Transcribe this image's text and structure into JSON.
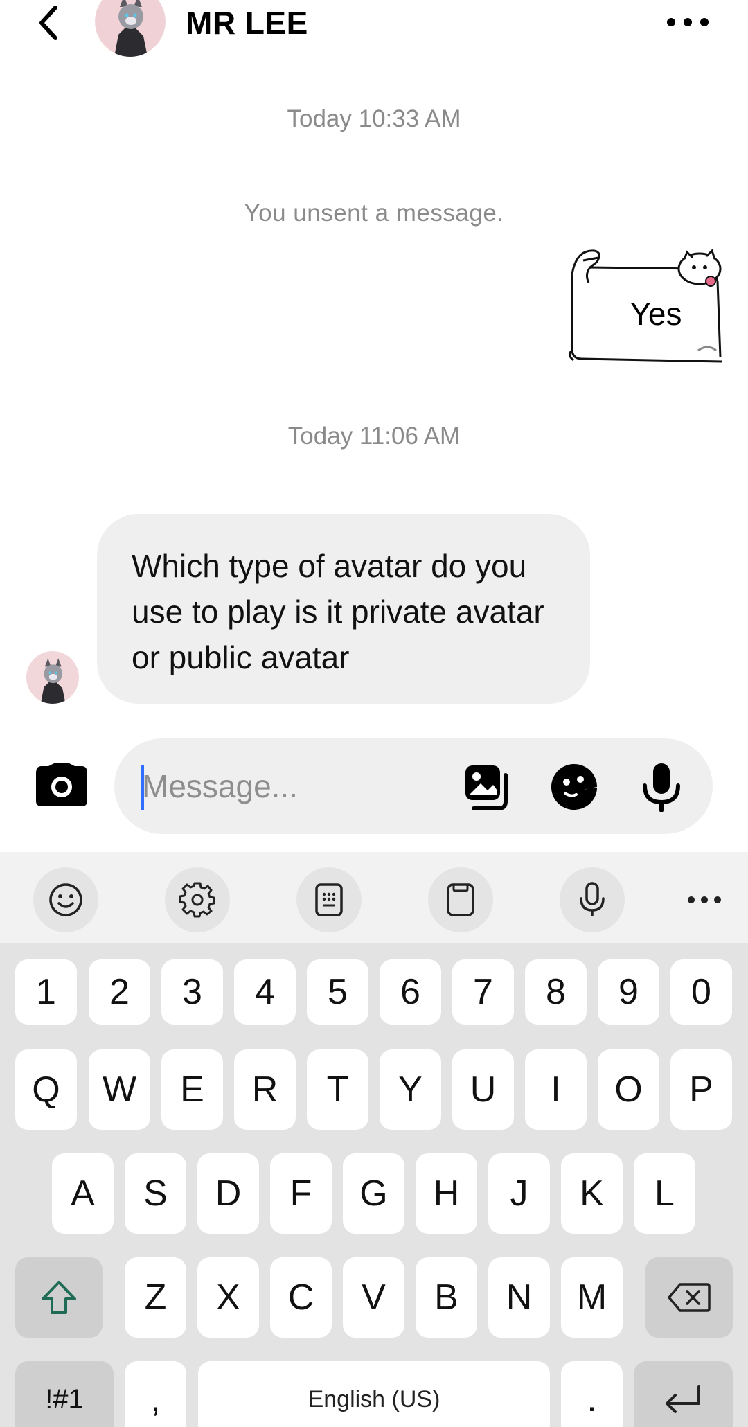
{
  "header": {
    "contact_name": "MR LEE",
    "back_icon": "chevron-left-icon",
    "more_icon": "more-horizontal-icon"
  },
  "chat": {
    "timestamp_1": "Today 10:33 AM",
    "system_message": "You unsent a message.",
    "sticker_text": "Yes",
    "timestamp_2": "Today 11:06 AM",
    "incoming_message": "Which type of avatar do you use to play is it private avatar or public avatar"
  },
  "composer": {
    "placeholder": "Message...",
    "icons": [
      "camera-icon",
      "gallery-icon",
      "sticker-icon",
      "microphone-icon"
    ]
  },
  "keyboard": {
    "toolbar_icons": [
      "emoji-icon",
      "settings-icon",
      "keypad-icon",
      "clipboard-icon",
      "voice-input-icon",
      "more-icon"
    ],
    "number_row": [
      "1",
      "2",
      "3",
      "4",
      "5",
      "6",
      "7",
      "8",
      "9",
      "0"
    ],
    "row_q": [
      "Q",
      "W",
      "E",
      "R",
      "T",
      "Y",
      "U",
      "I",
      "O",
      "P"
    ],
    "row_a": [
      "A",
      "S",
      "D",
      "F",
      "G",
      "H",
      "J",
      "K",
      "L"
    ],
    "row_z": [
      "Z",
      "X",
      "C",
      "V",
      "B",
      "N",
      "M"
    ],
    "symbols_key": "!#1",
    "comma_key": ",",
    "space_label": "English (US)",
    "period_key": "."
  }
}
